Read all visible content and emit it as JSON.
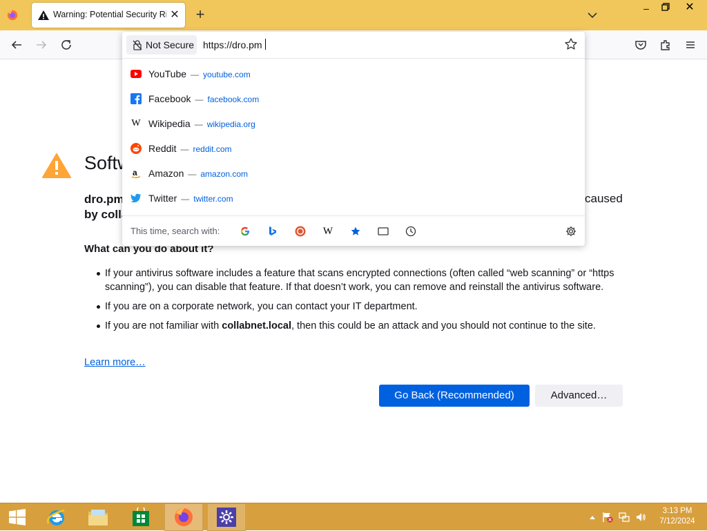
{
  "window": {
    "tab_title": "Warning: Potential Security Risk Ahead",
    "tab_close": "✕",
    "new_tab": "+",
    "minimize": "–",
    "close": "✕"
  },
  "urlbar": {
    "security_label": "Not Secure",
    "value": "https://dro.pm"
  },
  "suggestions": [
    {
      "title": "YouTube",
      "separator": "—",
      "url": "youtube.com",
      "icon": "youtube-icon"
    },
    {
      "title": "Facebook",
      "separator": "—",
      "url": "facebook.com",
      "icon": "facebook-icon"
    },
    {
      "title": "Wikipedia",
      "separator": "—",
      "url": "wikipedia.org",
      "icon": "wikipedia-icon"
    },
    {
      "title": "Reddit",
      "separator": "—",
      "url": "reddit.com",
      "icon": "reddit-icon"
    },
    {
      "title": "Amazon",
      "separator": "—",
      "url": "amazon.com",
      "icon": "amazon-icon"
    },
    {
      "title": "Twitter",
      "separator": "—",
      "url": "twitter.com",
      "icon": "twitter-icon"
    }
  ],
  "search_with": {
    "label": "This time, search with:",
    "engines": [
      "google-icon",
      "bing-icon",
      "duckduckgo-icon",
      "wikipedia-icon",
      "bookmarks-icon",
      "tabs-icon",
      "history-icon"
    ]
  },
  "page": {
    "heading": "Softw",
    "desc_line1": "dro.pm",
    "desc_line2": "by colla",
    "desc_right": "caused",
    "what_heading": "What can you do about it?",
    "bullet1": "If your antivirus software includes a feature that scans encrypted connections (often called “web scanning” or “https scanning”), you can disable that feature. If that doesn’t work, you can remove and reinstall the antivirus software.",
    "bullet2": "If you are on a corporate network, you can contact your IT department.",
    "bullet3_before": "If you are not familiar with ",
    "bullet3_bold": "collabnet.local",
    "bullet3_after": ", then this could be an attack and you should not continue to the site.",
    "learn_more": "Learn more…",
    "go_back": "Go Back (Recommended)",
    "advanced": "Advanced…"
  },
  "taskbar": {
    "time": "3:13 PM",
    "date": "7/12/2024"
  },
  "colors": {
    "titlebar": "#f1c75c",
    "accent": "#0061e0",
    "taskbar": "#d89f3e",
    "warning": "#ffa436"
  }
}
